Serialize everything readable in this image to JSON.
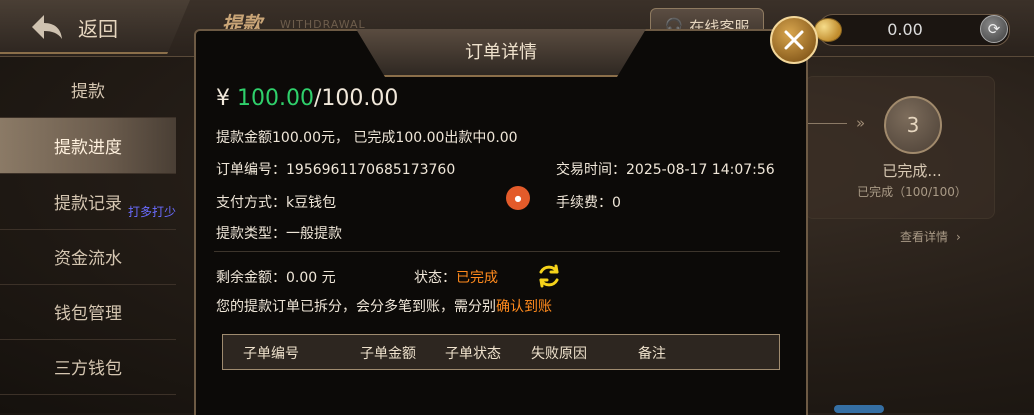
{
  "header": {
    "back_label": "返回",
    "page_title": "提款",
    "page_title_en": "WITHDRAWAL",
    "service_label": "在线客服",
    "balance": "0.00"
  },
  "sidebar": {
    "items": [
      {
        "label": "提款"
      },
      {
        "label": "提款进度",
        "active": true
      },
      {
        "label": "提款记录"
      },
      {
        "label": "资金流水"
      },
      {
        "label": "钱包管理"
      },
      {
        "label": "三方钱包"
      }
    ]
  },
  "watermark": "打多打少",
  "progress": {
    "step_number": "3",
    "step_label": "已完成...",
    "step_sub": "已完成（100/100）",
    "view_detail": "查看详情"
  },
  "modal": {
    "title": "订单详情",
    "currency": "¥",
    "amount_done": "100.00",
    "amount_total": "/100.00",
    "summary": "提款金额100.00元， 已完成100.00出款中0.00",
    "order_no_label": "订单编号：",
    "order_no": "1956961170685173760",
    "trade_time_label": "交易时间：",
    "trade_time": "2025-08-17 14:07:56",
    "pay_method_label": "支付方式：",
    "pay_method": "k豆钱包",
    "fee_label": "手续费：",
    "fee": "0",
    "type_label": "提款类型：",
    "type": "一般提款",
    "remaining_label": "剩余金额：",
    "remaining": "0.00 元",
    "status_label": "状态：",
    "status": "已完成",
    "split_notice": "您的提款订单已拆分，会分多笔到账，需分别",
    "confirm_link": "确认到账",
    "table_headers": [
      "子单编号",
      "子单金额",
      "子单状态",
      "失败原因",
      "备注"
    ]
  },
  "colors": {
    "accent_gold": "#c9a577",
    "success_green": "#2fd06b",
    "status_orange": "#ff8a1d"
  }
}
